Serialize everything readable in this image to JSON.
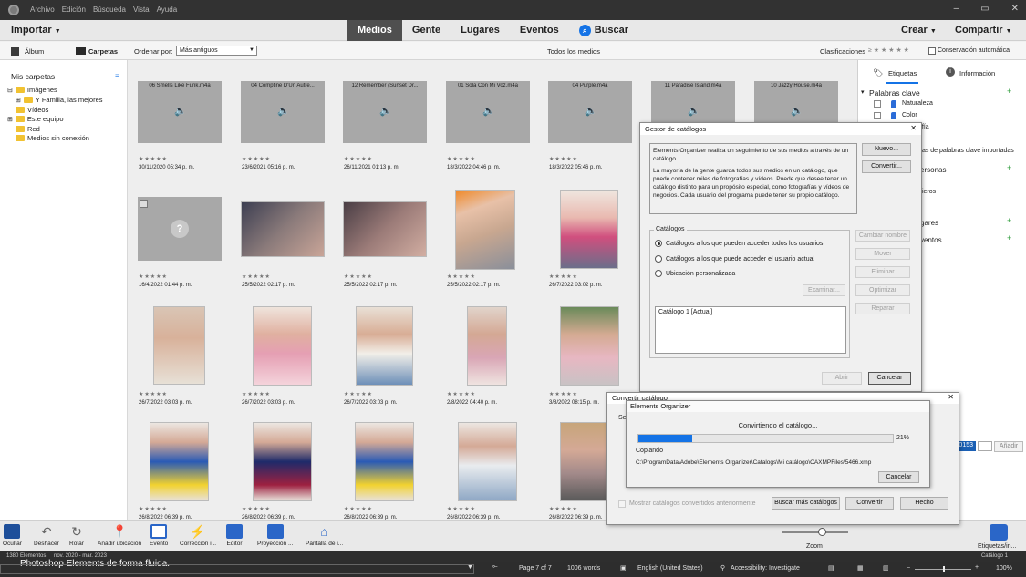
{
  "menu": [
    "Archivo",
    "Edición",
    "Búsqueda",
    "Vista",
    "Ayuda"
  ],
  "topbar": {
    "importar": "Importar",
    "tabs": [
      "Medios",
      "Gente",
      "Lugares",
      "Eventos"
    ],
    "buscar": "Buscar",
    "crear": "Crear",
    "compartir": "Compartir"
  },
  "subbar": {
    "album": "Álbum",
    "carpetas": "Carpetas",
    "ordenar_label": "Ordenar por:",
    "ordenar_value": "Más antiguos",
    "all_media": "Todos los medios",
    "clasificaciones": "Clasificaciones",
    "conservacion": "Conservación automática"
  },
  "leftpanel": {
    "title": "Mis carpetas",
    "items": [
      "Imágenes",
      "Y Familia, las mejores",
      "Vídeos",
      "Este equipo",
      "Red",
      "Medios sin conexión"
    ]
  },
  "grid": {
    "row1": [
      {
        "name": "06 Smells Like Funk.m4a",
        "date": "30/11/2020 05:34 p. m."
      },
      {
        "name": "04 Comptine D'Un Autre...",
        "date": "23/6/2021 05:16 p. m."
      },
      {
        "name": "12 Remember (Sunset Dr...",
        "date": "26/11/2021 01:13 p. m."
      },
      {
        "name": "01 Sola Con Mi Voz.m4a",
        "date": "18/3/2022 04:46 p. m."
      },
      {
        "name": "04 Purple.m4a",
        "date": "18/3/2022 05:46 p. m."
      },
      {
        "name": "11 Paradise Island.m4a",
        "date": ""
      },
      {
        "name": "10 Jazzy House.m4a",
        "date": ""
      }
    ],
    "row2": [
      "16/4/2022 01:44 p. m.",
      "25/5/2022 02:17 p. m.",
      "25/5/2022 02:17 p. m.",
      "25/5/2022 02:17 p. m.",
      "26/7/2022 03:02 p. m."
    ],
    "row3": [
      "26/7/2022 03:03 p. m.",
      "26/7/2022 03:03 p. m.",
      "26/7/2022 03:03 p. m.",
      "2/8/2022 04:40 p. m.",
      "3/8/2022 08:15 p. m."
    ],
    "row4": [
      "26/8/2022 06:39 p. m.",
      "26/8/2022 06:39 p. m.",
      "26/8/2022 06:39 p. m.",
      "26/8/2022 06:39 p. m.",
      "26/8/2022 06:39 p. m."
    ],
    "unknown": "?"
  },
  "rightpanel": {
    "etiquetas": "Etiquetas",
    "informacion": "Información",
    "palabras_clave": "Palabras clave",
    "keywords": [
      "Naturaleza",
      "Color"
    ],
    "partial": [
      "afía",
      "tas de palabras clave importadas",
      "ersonas",
      "fieros",
      "gares",
      "ventos"
    ],
    "code": "0153",
    "anadir": "Añadir"
  },
  "gestor": {
    "title": "Gestor de catálogos",
    "intro1": "Elements Organizer realiza un seguimiento de sus medios a través de un catálogo.",
    "intro2": "La mayoría de la gente guarda todos sus medios en un catálogo, que puede contener miles de fotografías y vídeos. Puede que desee tener un catálogo distinto para un propósito especial, como fotografías y vídeos de negocios. Cada usuario del programa puede tener su propio catálogo.",
    "nuevo": "Nuevo...",
    "convertir": "Convertir...",
    "catalogos": "Catálogos",
    "radio1": "Catálogos a los que pueden acceder todos los usuarios",
    "radio2": "Catálogos a los que puede acceder el usuario actual",
    "radio3": "Ubicación personalizada",
    "examinar": "Examinar...",
    "list_item": "Catálogo 1 [Actual]",
    "cambiar": "Cambiar nombre",
    "mover": "Mover",
    "eliminar": "Eliminar",
    "optimizar": "Optimizar",
    "reparar": "Reparar",
    "abrir": "Abrir",
    "cancelar": "Cancelar"
  },
  "convertir": {
    "title": "Convertir catálogo",
    "se": "Se",
    "mostrar": "Mostrar catálogos convertidos anteriormente",
    "buscar": "Buscar más catálogos",
    "convertir": "Convertir",
    "hecho": "Hecho"
  },
  "progress": {
    "title": "Elements Organizer",
    "msg": "Convirtiendo el catálogo...",
    "percent": 0.21,
    "percent_label": "21%",
    "copiando": "Copiando",
    "path": "C:\\ProgramData\\Adobe\\Elements Organizer\\Catalogs\\Mi catálogo\\CAXMPFiles\\5466.xmp",
    "cancelar": "Cancelar"
  },
  "bottom": {
    "tools": [
      "Ocultar",
      "Deshacer",
      "Rotar",
      "Añadir ubicación",
      "Evento",
      "Corrección i...",
      "Editor",
      "Proyección ...",
      "Pantalla de i..."
    ],
    "zoom": "Zoom",
    "etiquetas": "Etiquetas/in..."
  },
  "status": {
    "elementos": "1380 Elementos",
    "rango": "nov. 2020 - mar. 2023",
    "catalogo": "Catálogo 1"
  },
  "word": {
    "text": "Photoshop Elements de forma fluida.",
    "page": "Page 7 of 7",
    "words": "1006 words",
    "lang": "English (United States)",
    "access": "Accessibility: Investigate",
    "zoom": "100%"
  }
}
